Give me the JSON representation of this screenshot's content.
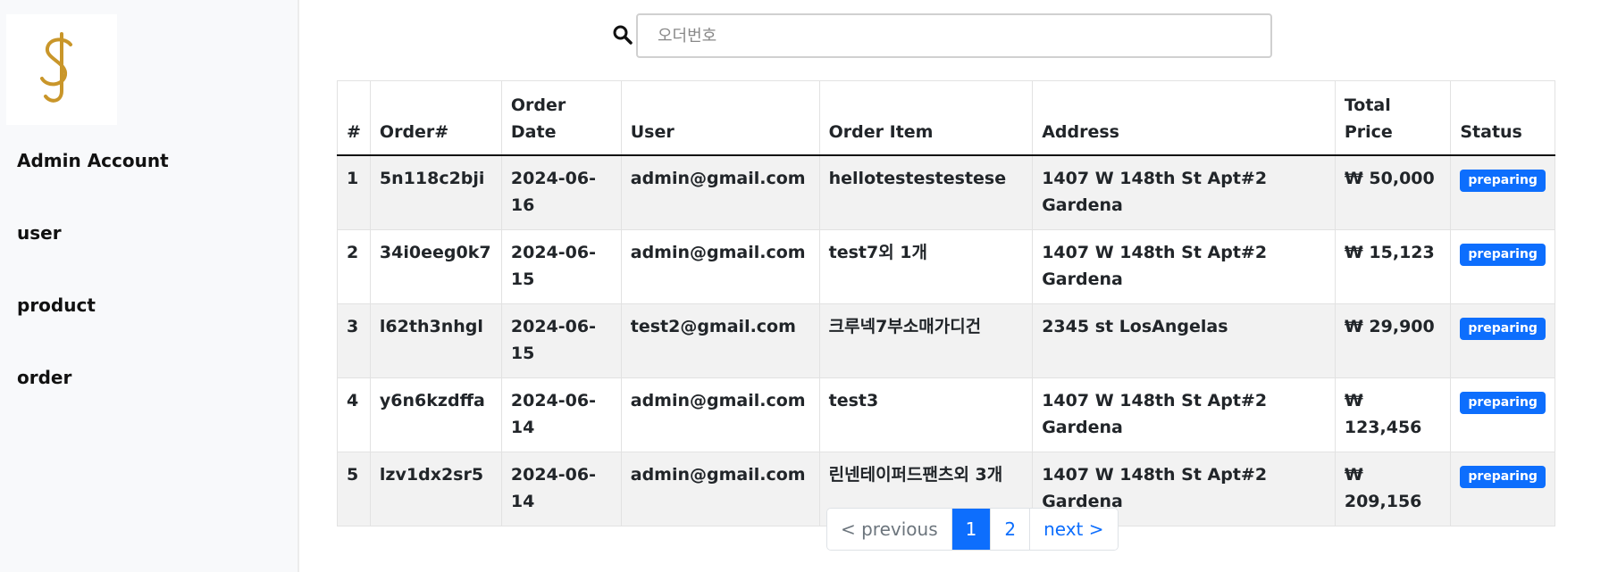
{
  "sidebar": {
    "logo_text": "SJ",
    "items": [
      {
        "label": "Admin Account"
      },
      {
        "label": "user"
      },
      {
        "label": "product"
      },
      {
        "label": "order"
      }
    ]
  },
  "search": {
    "placeholder": "오더번호",
    "value": ""
  },
  "table": {
    "headers": [
      "#",
      "Order#",
      "Order Date",
      "User",
      "Order Item",
      "Address",
      "Total Price",
      "Status"
    ],
    "rows": [
      [
        "1",
        "5n118c2bji",
        "2024-06-16",
        "admin@gmail.com",
        "hellotestestestese",
        "1407 W 148th St Apt#2 Gardena",
        "₩ 50,000",
        "preparing"
      ],
      [
        "2",
        "34i0eeg0k7",
        "2024-06-15",
        "admin@gmail.com",
        "test7외 1개",
        "1407 W 148th St Apt#2 Gardena",
        "₩ 15,123",
        "preparing"
      ],
      [
        "3",
        "l62th3nhgl",
        "2024-06-15",
        "test2@gmail.com",
        "크루넥7부소매가디건",
        "2345 st LosAngelas",
        "₩ 29,900",
        "preparing"
      ],
      [
        "4",
        "y6n6kzdffa",
        "2024-06-14",
        "admin@gmail.com",
        "test3",
        "1407 W 148th St Apt#2 Gardena",
        "₩ 123,456",
        "preparing"
      ],
      [
        "5",
        "lzv1dx2sr5",
        "2024-06-14",
        "admin@gmail.com",
        "린넨테이퍼드팬츠외 3개",
        "1407 W 148th St Apt#2 Gardena",
        "₩ 209,156",
        "preparing"
      ]
    ]
  },
  "pagination": {
    "previous": "< previous",
    "pages": [
      "1",
      "2"
    ],
    "current": "1",
    "next": "next >"
  },
  "colors": {
    "accent": "#0d6efd",
    "logo_gold": "#c9962a"
  }
}
